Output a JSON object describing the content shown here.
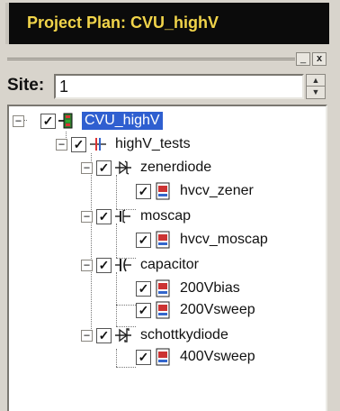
{
  "title_bar": {
    "title": "Project Plan: CVU_highV"
  },
  "window_buttons": {
    "minimize": "_",
    "close": "x"
  },
  "site": {
    "label": "Site:",
    "value": "1"
  },
  "tree": {
    "root": {
      "label": "CVU_highV",
      "expanded": true,
      "checked": true,
      "selected": true,
      "icon": "project-tree-icon"
    },
    "group": {
      "label": "highV_tests",
      "expanded": true,
      "checked": true,
      "icon": "test-group-icon"
    },
    "devices": [
      {
        "label": "zenerdiode",
        "icon": "zener-diode-icon",
        "tests": [
          "hvcv_zener"
        ]
      },
      {
        "label": "moscap",
        "icon": "moscap-icon",
        "tests": [
          "hvcv_moscap"
        ]
      },
      {
        "label": "capacitor",
        "icon": "capacitor-icon",
        "tests": [
          "200Vbias",
          "200Vsweep"
        ]
      },
      {
        "label": "schottkydiode",
        "icon": "schottky-diode-icon",
        "tests": [
          "400Vsweep"
        ]
      }
    ]
  },
  "colors": {
    "title_bg": "#0b0b0b",
    "title_text": "#f1d44a",
    "selection": "#2f5fd0"
  }
}
